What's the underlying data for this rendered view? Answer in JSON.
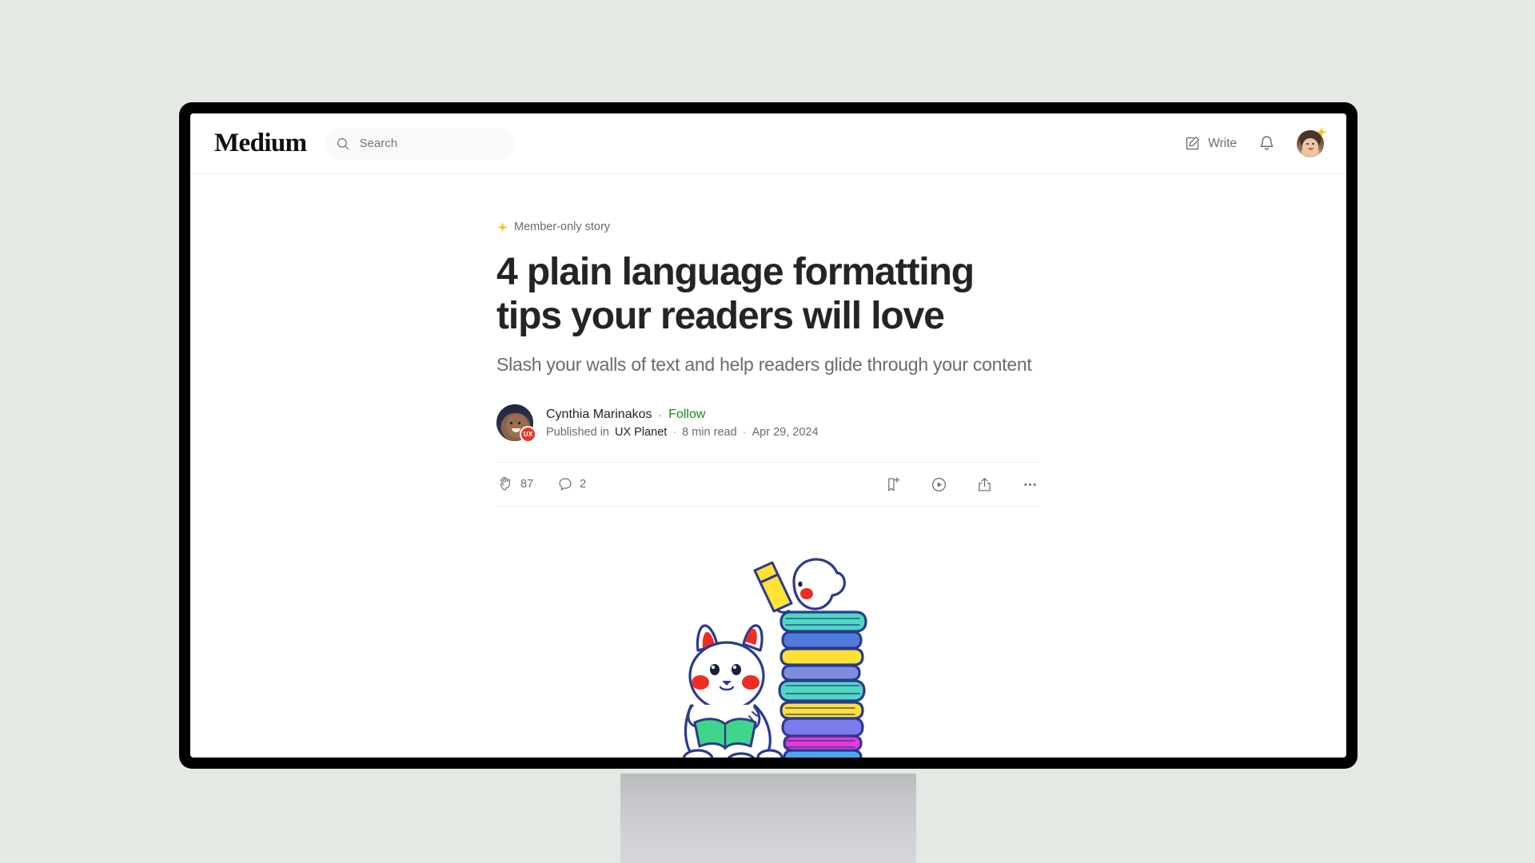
{
  "window": {
    "device": "desktop-monitor"
  },
  "topbar": {
    "brand": "Medium",
    "search": {
      "placeholder": "Search",
      "value": "",
      "icon": "search-icon"
    },
    "write_label": "Write",
    "write_icon": "write-pencil-icon",
    "notifications_icon": "bell-icon",
    "avatar_icon": "user-avatar",
    "avatar_badge_icon": "sparkle-icon"
  },
  "article": {
    "member_tag": {
      "icon": "star-four-point-icon",
      "label": "Member-only story",
      "star_color": "#f5c518"
    },
    "title": "4 plain language formatting tips your readers will love",
    "subtitle": "Slash your walls of text and help readers glide through your content",
    "byline": {
      "author": "Cynthia Marinakos",
      "separator": "·",
      "follow_label": "Follow",
      "follow_color": "#1a8917",
      "published_in_label": "Published in",
      "publication": "UX Planet",
      "publication_badge": "UX",
      "publication_badge_color": "#e2392a",
      "read_time": "8 min read",
      "date": "Apr 29, 2024",
      "meta_separator": "·"
    },
    "engagement": {
      "claps_icon": "clap-icon",
      "claps_count": "87",
      "comments_icon": "comment-bubble-icon",
      "comments_count": "2",
      "save_icon": "bookmark-add-icon",
      "listen_icon": "play-circle-icon",
      "share_icon": "share-icon",
      "more_icon": "ellipsis-icon"
    },
    "hero_image": {
      "name": "cats-reading-books-illustration",
      "alt": "Two white cat characters reading, one sitting on a tall stack of colorful books",
      "colors": {
        "outline": "#2b3a8f",
        "cheek": "#ee2d24",
        "green_book": "#3fd68a",
        "yellow_book": "#ffe234",
        "blue_book": "#3a72d8",
        "teal_book": "#4fd8c0",
        "purple_book": "#6d6ee0",
        "magenta_book": "#e838d8"
      }
    }
  },
  "theme": {
    "page_background": "#e4e9e3",
    "bezel": "#000000",
    "screen": "#ffffff",
    "text_primary": "#242424",
    "text_secondary": "#6b6b6b"
  }
}
